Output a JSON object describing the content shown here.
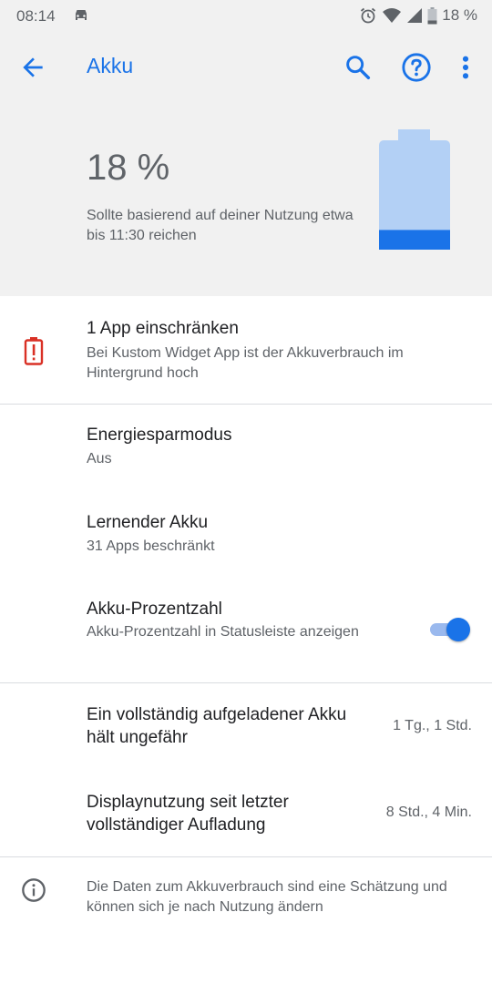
{
  "status_bar": {
    "time": "08:14",
    "battery_text": "18 %"
  },
  "app_bar": {
    "title": "Akku"
  },
  "header": {
    "percentage": "18 %",
    "estimate": "Sollte basierend auf deiner Nutzung etwa bis 11:30 reichen",
    "battery_level": 0.18
  },
  "restrict": {
    "title": "1 App einschränken",
    "subtitle": "Bei Kustom Widget App ist der Akkuverbrauch im Hintergrund hoch"
  },
  "settings": [
    {
      "title": "Energiesparmodus",
      "subtitle": "Aus"
    },
    {
      "title": "Lernender Akku",
      "subtitle": "31 Apps beschränkt"
    },
    {
      "title": "Akku-Prozentzahl",
      "subtitle": "Akku-Prozentzahl in Statusleiste anzeigen",
      "toggle_on": true
    }
  ],
  "usage": [
    {
      "label": "Ein vollständig aufgeladener Akku hält ungefähr",
      "value": "1 Tg., 1 Std."
    },
    {
      "label": "Displaynutzung seit letzter vollständiger Aufladung",
      "value": "8 Std., 4 Min."
    }
  ],
  "footer": {
    "text": "Die Daten zum Akkuverbrauch sind eine Schätzung und können sich je nach Nutzung ändern"
  },
  "colors": {
    "accent": "#1a73e8",
    "battery_fill": "#1a73e8",
    "battery_bg": "#b3d0f5",
    "alert": "#d93025"
  }
}
